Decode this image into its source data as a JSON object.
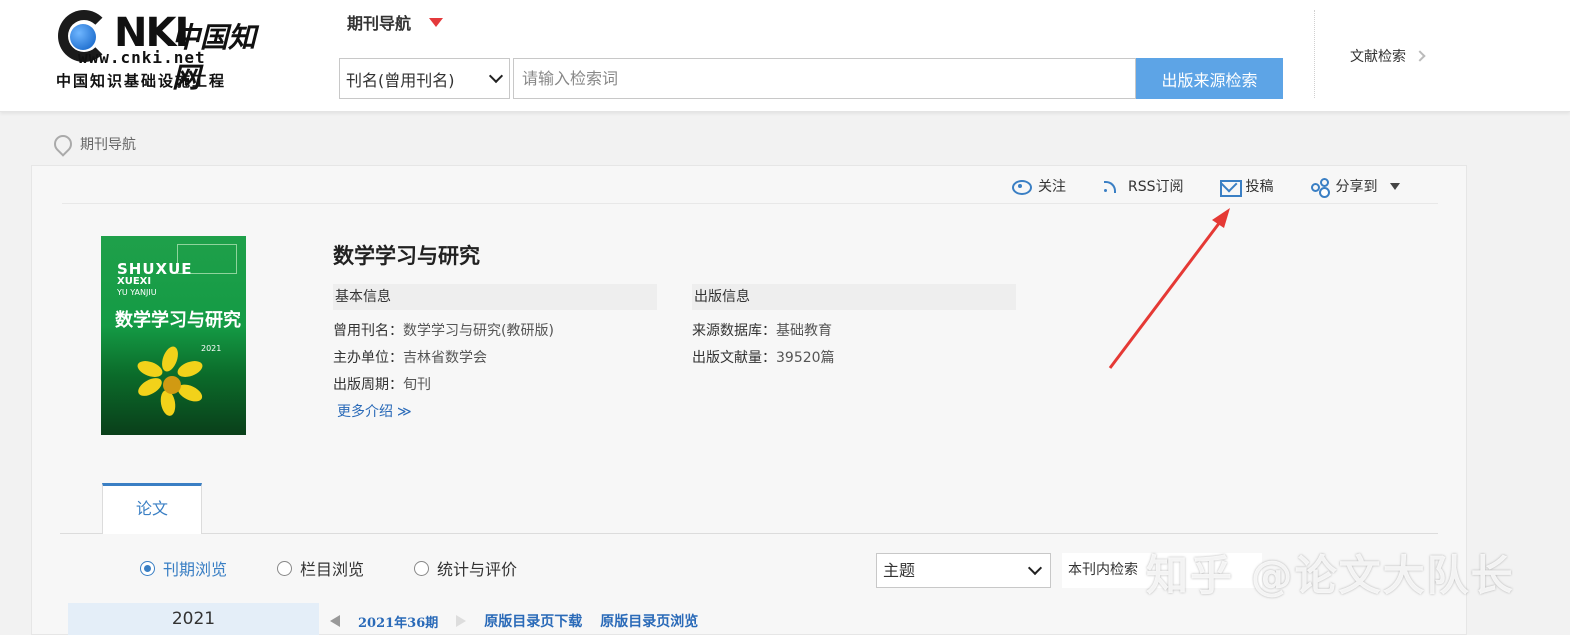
{
  "header": {
    "logo": {
      "mark": "NKI",
      "cn_name": "中国知网",
      "url": "www.cnki.net",
      "subtitle": "中国知识基础设施工程"
    },
    "nav_title": "期刊导航",
    "search": {
      "type_value": "刊名(曾用刊名)",
      "placeholder": "请输入检索词",
      "button_label": "出版来源检索"
    },
    "lit_search": "文献检索"
  },
  "breadcrumb": "期刊导航",
  "actions": {
    "follow": "关注",
    "rss": "RSS订阅",
    "submit": "投稿",
    "share": "分享到"
  },
  "cover": {
    "line1": "SHUXUE",
    "line2": "XUEXI",
    "line3": "YU YANJIU",
    "title": "数学学习与研究",
    "year": "2021"
  },
  "journal": {
    "title": "数学学习与研究",
    "basic": {
      "heading": "基本信息",
      "former_name_label": "曾用刊名：",
      "former_name": "数学学习与研究(教研版)",
      "sponsor_label": "主办单位：",
      "sponsor": "吉林省数学会",
      "cycle_label": "出版周期：",
      "cycle": "旬刊",
      "more": "更多介绍",
      "more_icon": "≫"
    },
    "publish": {
      "heading": "出版信息",
      "db_label": "来源数据库：",
      "db": "基础教育",
      "count_label": "出版文献量：",
      "count": "39520篇"
    }
  },
  "tabs": {
    "paper": "论文"
  },
  "browse": {
    "issue_browse": "刊期浏览",
    "column_browse": "栏目浏览",
    "stats": "统计与评价"
  },
  "filter": {
    "topic": "主题",
    "inner_search": "本刊内检索"
  },
  "year": "2021",
  "issue": {
    "current": "2021年36期",
    "download": "原版目录页下载",
    "view": "原版目录页浏览"
  },
  "watermark": "知乎 @论文大队长",
  "colors": {
    "accent": "#3a7fc4",
    "search_button": "#5da4e6",
    "nav_triangle": "#e4393c",
    "annotation_arrow": "#e53935"
  }
}
